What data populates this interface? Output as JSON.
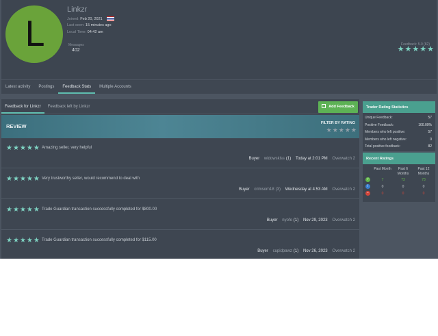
{
  "profile": {
    "avatar_letter": "L",
    "username": "Linkzr",
    "joined_label": "Joined:",
    "joined_value": "Feb 20, 2021",
    "last_seen_label": "Last seen:",
    "last_seen_value": "15 minutes ago",
    "local_time_label": "Local Time:",
    "local_time_value": "04:42 am",
    "messages_label": "Messages",
    "messages_value": "402",
    "feedback_label": "Feedback: 5.0 (82)",
    "feedback_rating": 5
  },
  "profile_tabs": [
    "Latest activity",
    "Postings",
    "Feedback Stats",
    "Multiple Accounts"
  ],
  "active_profile_tab": "Feedback Stats",
  "feedback_tabs": [
    "Feedback for Linkzr",
    "Feedback left by Linkzr"
  ],
  "add_feedback_label": "Add Feedback",
  "review_header": "REVIEW",
  "filter_header": "FILTER BY RATING",
  "reviews": [
    {
      "rating": 5,
      "text": "Amazing seller, very helpful",
      "role": "Buyer",
      "user": "widowskiss",
      "count": "(1)",
      "date": "Today at 2:01 PM",
      "game": "Overwatch 2"
    },
    {
      "rating": 5,
      "text": "Very trustworthy seller, would recommend to deal with",
      "role": "Buyer",
      "user": "crimsom18",
      "count": "(3)",
      "date": "Wednesday at 4:53 AM",
      "game": "Overwatch 2"
    },
    {
      "rating": 5,
      "text": "Trade Guardian transaction successfully completed for $800.00",
      "role": "Buyer",
      "user": "nyofe",
      "count": "(1)",
      "date": "Nov 29, 2023",
      "game": "Overwatch 2"
    },
    {
      "rating": 5,
      "text": "Trade Guardian transaction successfully completed for $115.00",
      "role": "Buyer",
      "user": "cupidpawz",
      "count": "(1)",
      "date": "Nov 26, 2023",
      "game": "Overwatch 2"
    }
  ],
  "trader_stats": {
    "title": "Trader Rating Statistics",
    "rows": [
      {
        "label": "Unique Feedback:",
        "value": "57"
      },
      {
        "label": "Positive Feedback:",
        "value": "100.00%"
      },
      {
        "label": "Members who left positive:",
        "value": "57"
      },
      {
        "label": "Members who left negative:",
        "value": "0"
      },
      {
        "label": "Total positive feedback:",
        "value": "82"
      }
    ]
  },
  "recent_ratings": {
    "title": "Recent Ratings",
    "columns": [
      "Past Month",
      "Past 6 Months",
      "Past 12 Months"
    ],
    "rows": [
      {
        "type": "positive",
        "values": [
          "7",
          "73",
          "73"
        ],
        "color": "#63b94a"
      },
      {
        "type": "neutral",
        "values": [
          "0",
          "0",
          "0"
        ],
        "color": "#3a7fd0"
      },
      {
        "type": "negative",
        "values": [
          "0",
          "0",
          "0"
        ],
        "color": "#d2473c"
      }
    ]
  }
}
